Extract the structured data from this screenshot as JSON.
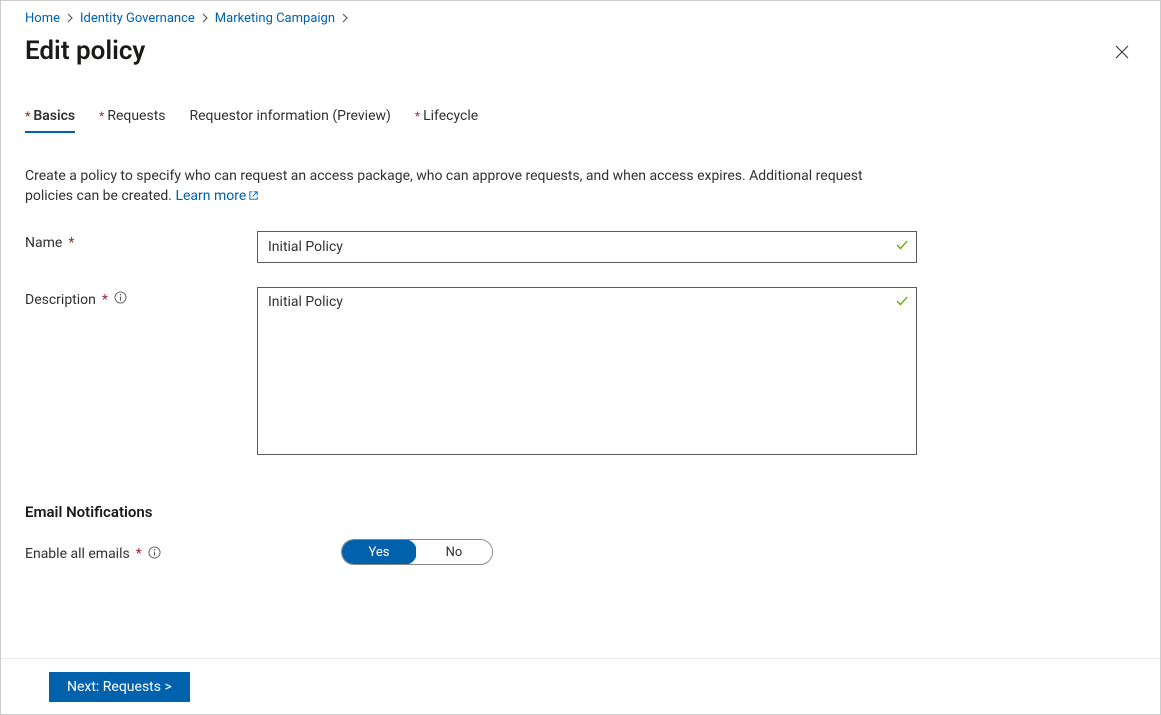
{
  "breadcrumb": {
    "items": [
      "Home",
      "Identity Governance",
      "Marketing Campaign"
    ]
  },
  "header": {
    "title": "Edit policy"
  },
  "tabs": [
    {
      "label": "Basics",
      "required": true,
      "active": true
    },
    {
      "label": "Requests",
      "required": true,
      "active": false
    },
    {
      "label": "Requestor information (Preview)",
      "required": false,
      "active": false
    },
    {
      "label": "Lifecycle",
      "required": true,
      "active": false
    }
  ],
  "intro": {
    "text": "Create a policy to specify who can request an access package, who can approve requests, and when access expires. Additional request policies can be created. ",
    "learn_more": "Learn more"
  },
  "form": {
    "name_label": "Name",
    "name_value": "Initial Policy",
    "desc_label": "Description",
    "desc_value": "Initial Policy"
  },
  "email_section": {
    "heading": "Email Notifications",
    "enable_label": "Enable all emails",
    "yes": "Yes",
    "no": "No",
    "selected": "Yes"
  },
  "footer": {
    "next_label": "Next: Requests >"
  }
}
